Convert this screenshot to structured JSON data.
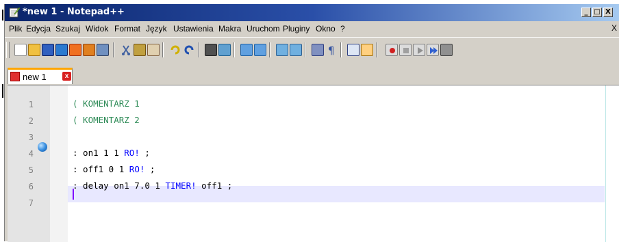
{
  "window": {
    "title": "*new 1 - Notepad++",
    "min_label": "_",
    "max_label": "□",
    "close_label": "X"
  },
  "menu": {
    "items": [
      "Plik",
      "Edycja",
      "Szukaj",
      "Widok",
      "Format",
      "Język",
      "Ustawienia",
      "Makra",
      "Uruchom",
      "Pluginy",
      "Okno",
      "?"
    ],
    "close_label": "X"
  },
  "tabs": [
    {
      "label": "new 1",
      "close_label": "x"
    }
  ],
  "editor": {
    "line_numbers": [
      "1",
      "2",
      "3",
      "4",
      "5",
      "6",
      "7"
    ],
    "lines": [
      {
        "text": "( KOMENTARZ 1"
      },
      {
        "text": "( KOMENTARZ 2"
      },
      {
        "text": ""
      },
      {
        "before": ": on1 1 1 ",
        "keyword": "RO!",
        "after": " ;"
      },
      {
        "before": ": off1 0 1 ",
        "keyword": "RO!",
        "after": " ;"
      },
      {
        "before": ": delay on1 7.0 1 ",
        "keyword": "TIMER!",
        "after": " off1 ;"
      },
      {
        "text": ""
      }
    ],
    "bookmark_line": 4,
    "current_line": 7
  },
  "toolbar_icons": [
    "new-file-icon",
    "open-file-icon",
    "save-icon",
    "save-all-icon",
    "close-icon",
    "close-all-icon",
    "print-icon",
    "cut-icon",
    "copy-icon",
    "paste-icon",
    "undo-icon",
    "redo-icon",
    "find-icon",
    "replace-icon",
    "zoom-in-icon",
    "zoom-out-icon",
    "sync-vertical-icon",
    "sync-horizontal-icon",
    "word-wrap-icon",
    "show-all-characters-icon",
    "indent-guide-icon",
    "user-language-icon",
    "record-macro-icon",
    "stop-macro-icon",
    "play-macro-icon",
    "run-macro-multiple-icon",
    "save-macro-icon"
  ],
  "colors": {
    "title_gradient_start": "#0a246a",
    "title_gradient_end": "#a6caf0",
    "comment": "#2e8b57",
    "keyword": "#0000ff",
    "current_line_bg": "#e8e8ff",
    "tab_accent": "#ffa500"
  }
}
